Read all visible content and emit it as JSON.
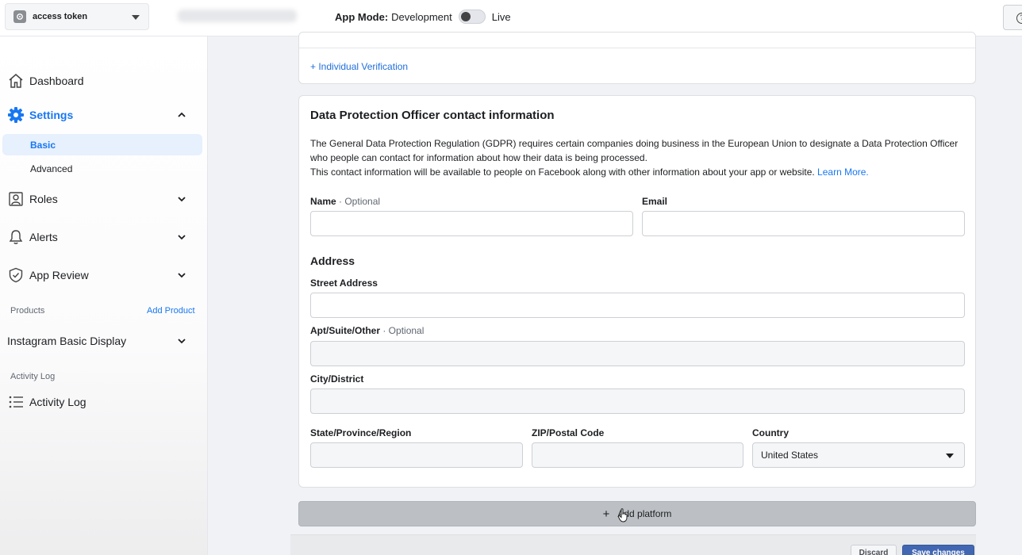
{
  "topbar": {
    "app_name": "access token",
    "app_mode_label": "App Mode:",
    "app_mode_value": "Development",
    "live_label": "Live",
    "help_icon": "question-icon"
  },
  "sidebar": {
    "dashboard": "Dashboard",
    "settings": "Settings",
    "settings_sub": {
      "basic": "Basic",
      "advanced": "Advanced"
    },
    "roles": "Roles",
    "alerts": "Alerts",
    "app_review": "App Review",
    "products_label": "Products",
    "add_product": "Add Product",
    "instagram": "Instagram Basic Display",
    "activity_log_section": "Activity Log",
    "activity_log": "Activity Log",
    "accent_color": "#1877f2"
  },
  "verification": {
    "link": "+ Individual Verification"
  },
  "dpo": {
    "title": "Data Protection Officer contact information",
    "desc_line1": "The General Data Protection Regulation (GDPR) requires certain companies doing business in the European Union to designate a Data Protection Officer who people can contact for information about how their data is being processed.",
    "desc_line2": "This contact information will be available to people on Facebook along with other information about your app or website.",
    "learn_more": "Learn More.",
    "name_label": "Name",
    "optional_suffix": " · Optional",
    "email_label": "Email",
    "address_title": "Address",
    "street_label": "Street Address",
    "apt_label": "Apt/Suite/Other",
    "city_label": "City/District",
    "state_label": "State/Province/Region",
    "zip_label": "ZIP/Postal Code",
    "country_label": "Country",
    "country_value": "United States"
  },
  "footer": {
    "add_platform": "Add platform",
    "discard": "Discard",
    "save": "Save changes"
  }
}
